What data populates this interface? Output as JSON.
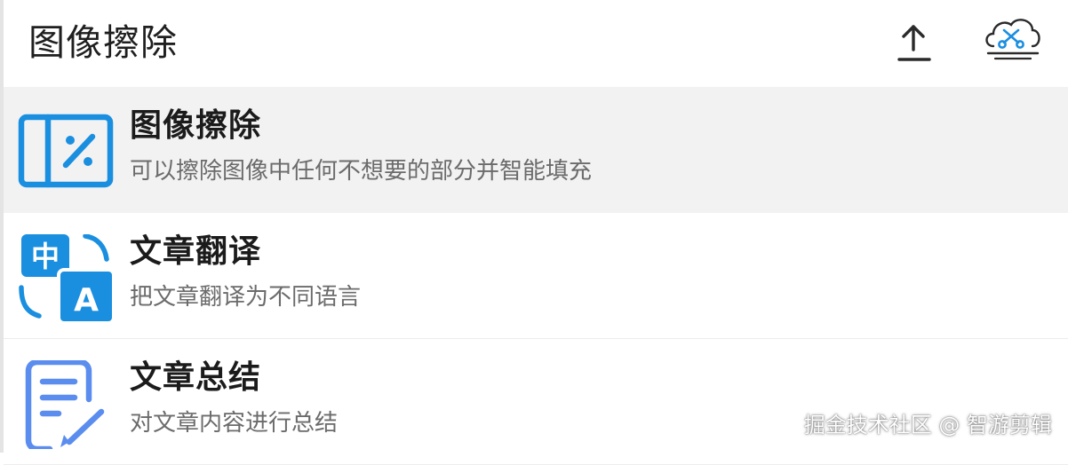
{
  "header": {
    "title": "图像擦除",
    "upload_icon": "upload-icon",
    "cloud_icon": "cloud-scissors-icon"
  },
  "items": [
    {
      "title": "图像擦除",
      "description": "可以擦除图像中任何不想要的部分并智能填充",
      "icon": "image-erase-icon",
      "selected": true
    },
    {
      "title": "文章翻译",
      "description": "把文章翻译为不同语言",
      "icon": "translate-icon",
      "icon_text_cn": "中",
      "icon_text_en": "A"
    },
    {
      "title": "文章总结",
      "description": "对文章内容进行总结",
      "icon": "document-edit-icon"
    }
  ],
  "watermark": "掘金技术社区 @ 智游剪辑",
  "colors": {
    "icon_blue": "#1a8fe0",
    "icon_periwinkle": "#5b8def",
    "selected_bg": "#f2f2f2"
  }
}
